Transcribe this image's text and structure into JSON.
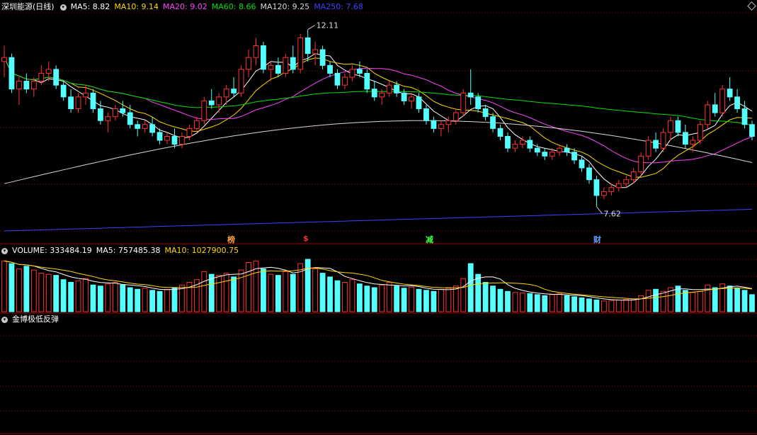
{
  "main_panel": {
    "stock_name": "深圳能源(日线)",
    "ma_labels": [
      {
        "text": "MA5: 8.82",
        "color": "#ffffff"
      },
      {
        "text": "MA10: 9.14",
        "color": "#ffd700"
      },
      {
        "text": "MA20: 9.02",
        "color": "#ff44ff"
      },
      {
        "text": "MA60: 8.66",
        "color": "#00e000"
      },
      {
        "text": "MA120: 9.25",
        "color": "#d8d8d8"
      },
      {
        "text": "MA250: 7.68",
        "color": "#4040ff"
      }
    ],
    "high_label": "12.11",
    "low_label": "7.62",
    "markers": [
      {
        "text": "榜",
        "color": "#ffa040"
      },
      {
        "text": "$",
        "color": "#ff3030"
      },
      {
        "text": "减",
        "color": "#40ff40"
      },
      {
        "text": "财",
        "color": "#60a0ff"
      }
    ]
  },
  "volume_panel": {
    "label": "VOLUME: 333484.19",
    "ma5": "MA5: 757485.38",
    "ma10": "MA10: 1027900.75"
  },
  "indicator_panel": {
    "label": "金博极低反弹"
  },
  "colors": {
    "up": "#ff3232",
    "down": "#54ffff",
    "grid": "#8b0000",
    "signal": "#ffff00"
  },
  "chart_data": {
    "type": "candlestick",
    "price_range": [
      7.0,
      12.5
    ],
    "candles": [
      [
        11.3,
        11.7,
        10.9,
        11.4
      ],
      [
        11.4,
        11.5,
        10.5,
        10.6
      ],
      [
        10.6,
        10.9,
        10.2,
        10.8
      ],
      [
        10.8,
        11.0,
        10.5,
        10.6
      ],
      [
        10.6,
        10.9,
        10.4,
        10.8
      ],
      [
        10.8,
        11.2,
        10.7,
        11.0
      ],
      [
        11.0,
        11.3,
        10.8,
        11.1
      ],
      [
        11.1,
        11.2,
        10.6,
        10.7
      ],
      [
        10.7,
        10.8,
        10.3,
        10.4
      ],
      [
        10.4,
        10.6,
        10.0,
        10.1
      ],
      [
        10.1,
        10.5,
        10.0,
        10.4
      ],
      [
        10.4,
        10.7,
        10.2,
        10.5
      ],
      [
        10.5,
        10.6,
        10.0,
        10.1
      ],
      [
        10.1,
        10.3,
        9.7,
        9.8
      ],
      [
        9.8,
        10.0,
        9.5,
        9.9
      ],
      [
        9.9,
        10.2,
        9.8,
        10.1
      ],
      [
        10.1,
        10.3,
        9.9,
        10.0
      ],
      [
        10.0,
        10.2,
        9.6,
        9.7
      ],
      [
        9.7,
        9.8,
        9.4,
        9.6
      ],
      [
        9.6,
        9.8,
        9.5,
        9.7
      ],
      [
        9.7,
        9.9,
        9.4,
        9.5
      ],
      [
        9.5,
        9.6,
        9.2,
        9.3
      ],
      [
        9.3,
        9.5,
        9.2,
        9.4
      ],
      [
        9.4,
        9.6,
        9.1,
        9.2
      ],
      [
        9.2,
        9.5,
        9.1,
        9.4
      ],
      [
        9.4,
        9.7,
        9.3,
        9.6
      ],
      [
        9.6,
        9.9,
        9.5,
        9.8
      ],
      [
        9.8,
        10.4,
        9.7,
        10.3
      ],
      [
        10.3,
        10.6,
        10.1,
        10.2
      ],
      [
        10.2,
        10.5,
        10.0,
        10.4
      ],
      [
        10.4,
        10.7,
        10.2,
        10.6
      ],
      [
        10.6,
        10.9,
        10.4,
        10.5
      ],
      [
        10.5,
        11.2,
        10.4,
        11.1
      ],
      [
        11.1,
        11.6,
        10.9,
        11.4
      ],
      [
        11.4,
        11.9,
        11.2,
        11.7
      ],
      [
        11.7,
        11.8,
        11.0,
        11.1
      ],
      [
        11.1,
        11.3,
        10.8,
        11.2
      ],
      [
        11.2,
        11.4,
        10.9,
        11.0
      ],
      [
        11.0,
        11.5,
        10.9,
        11.4
      ],
      [
        11.4,
        11.7,
        11.0,
        11.1
      ],
      [
        11.1,
        12.0,
        11.0,
        11.9
      ],
      [
        11.9,
        12.11,
        11.3,
        11.5
      ],
      [
        11.5,
        11.8,
        11.2,
        11.6
      ],
      [
        11.6,
        11.7,
        11.1,
        11.2
      ],
      [
        11.2,
        11.3,
        10.9,
        11.0
      ],
      [
        11.0,
        11.1,
        10.6,
        10.7
      ],
      [
        10.7,
        11.0,
        10.6,
        10.9
      ],
      [
        10.9,
        11.2,
        10.8,
        11.1
      ],
      [
        11.1,
        11.3,
        10.9,
        11.0
      ],
      [
        11.0,
        11.1,
        10.5,
        10.6
      ],
      [
        10.6,
        10.8,
        10.3,
        10.4
      ],
      [
        10.4,
        10.6,
        10.2,
        10.5
      ],
      [
        10.5,
        10.8,
        10.4,
        10.7
      ],
      [
        10.7,
        10.8,
        10.4,
        10.5
      ],
      [
        10.5,
        10.6,
        10.2,
        10.3
      ],
      [
        10.3,
        10.5,
        10.1,
        10.4
      ],
      [
        10.4,
        10.5,
        10.0,
        10.1
      ],
      [
        10.1,
        10.2,
        9.7,
        9.8
      ],
      [
        9.8,
        9.9,
        9.5,
        9.6
      ],
      [
        9.6,
        9.8,
        9.4,
        9.7
      ],
      [
        9.7,
        9.9,
        9.5,
        9.8
      ],
      [
        9.8,
        10.1,
        9.7,
        10.0
      ],
      [
        10.0,
        10.6,
        9.9,
        10.5
      ],
      [
        10.5,
        11.1,
        10.2,
        10.4
      ],
      [
        10.4,
        10.5,
        10.0,
        10.1
      ],
      [
        10.1,
        10.2,
        9.8,
        9.9
      ],
      [
        9.9,
        10.0,
        9.5,
        9.6
      ],
      [
        9.6,
        9.7,
        9.3,
        9.4
      ],
      [
        9.4,
        9.5,
        9.0,
        9.1
      ],
      [
        9.1,
        9.3,
        9.0,
        9.2
      ],
      [
        9.2,
        9.4,
        9.1,
        9.3
      ],
      [
        9.3,
        9.4,
        9.0,
        9.1
      ],
      [
        9.1,
        9.2,
        8.9,
        9.0
      ],
      [
        9.0,
        9.1,
        8.8,
        8.9
      ],
      [
        8.9,
        9.1,
        8.8,
        9.0
      ],
      [
        9.0,
        9.2,
        8.9,
        9.1
      ],
      [
        9.1,
        9.2,
        8.9,
        9.0
      ],
      [
        9.0,
        9.1,
        8.7,
        8.8
      ],
      [
        8.8,
        8.9,
        8.5,
        8.6
      ],
      [
        8.6,
        8.7,
        8.2,
        8.3
      ],
      [
        8.3,
        8.4,
        7.62,
        7.9
      ],
      [
        7.9,
        8.1,
        7.8,
        8.0
      ],
      [
        8.0,
        8.2,
        7.9,
        8.1
      ],
      [
        8.1,
        8.3,
        8.0,
        8.2
      ],
      [
        8.2,
        8.4,
        8.1,
        8.3
      ],
      [
        8.3,
        8.6,
        8.2,
        8.5
      ],
      [
        8.5,
        9.0,
        8.4,
        8.9
      ],
      [
        8.9,
        9.4,
        8.8,
        9.3
      ],
      [
        9.3,
        9.5,
        9.0,
        9.1
      ],
      [
        9.1,
        9.6,
        9.0,
        9.5
      ],
      [
        9.5,
        9.9,
        9.3,
        9.8
      ],
      [
        9.8,
        9.9,
        9.4,
        9.5
      ],
      [
        9.5,
        9.7,
        9.1,
        9.2
      ],
      [
        9.2,
        9.4,
        9.0,
        9.3
      ],
      [
        9.3,
        9.8,
        9.2,
        9.7
      ],
      [
        9.7,
        10.3,
        9.6,
        10.2
      ],
      [
        10.2,
        10.5,
        9.9,
        10.0
      ],
      [
        10.0,
        10.7,
        9.9,
        10.6
      ],
      [
        10.6,
        10.9,
        10.3,
        10.4
      ],
      [
        10.4,
        10.6,
        10.0,
        10.1
      ],
      [
        10.1,
        10.3,
        9.6,
        9.7
      ],
      [
        9.7,
        9.8,
        9.3,
        9.4
      ]
    ],
    "volume": [
      95,
      90,
      80,
      85,
      78,
      72,
      70,
      68,
      60,
      55,
      58,
      62,
      50,
      48,
      52,
      55,
      50,
      45,
      42,
      44,
      40,
      38,
      42,
      45,
      50,
      55,
      60,
      75,
      70,
      68,
      72,
      65,
      78,
      92,
      95,
      80,
      70,
      68,
      75,
      70,
      90,
      98,
      80,
      72,
      65,
      58,
      55,
      60,
      52,
      48,
      45,
      50,
      55,
      48,
      44,
      46,
      42,
      40,
      38,
      42,
      44,
      48,
      62,
      90,
      70,
      55,
      48,
      42,
      38,
      36,
      35,
      34,
      32,
      30,
      32,
      34,
      30,
      28,
      26,
      24,
      22,
      20,
      21,
      22,
      23,
      24,
      30,
      40,
      42,
      38,
      45,
      48,
      40,
      36,
      38,
      50,
      45,
      52,
      48,
      44,
      40,
      32
    ],
    "signal_index": 103
  }
}
